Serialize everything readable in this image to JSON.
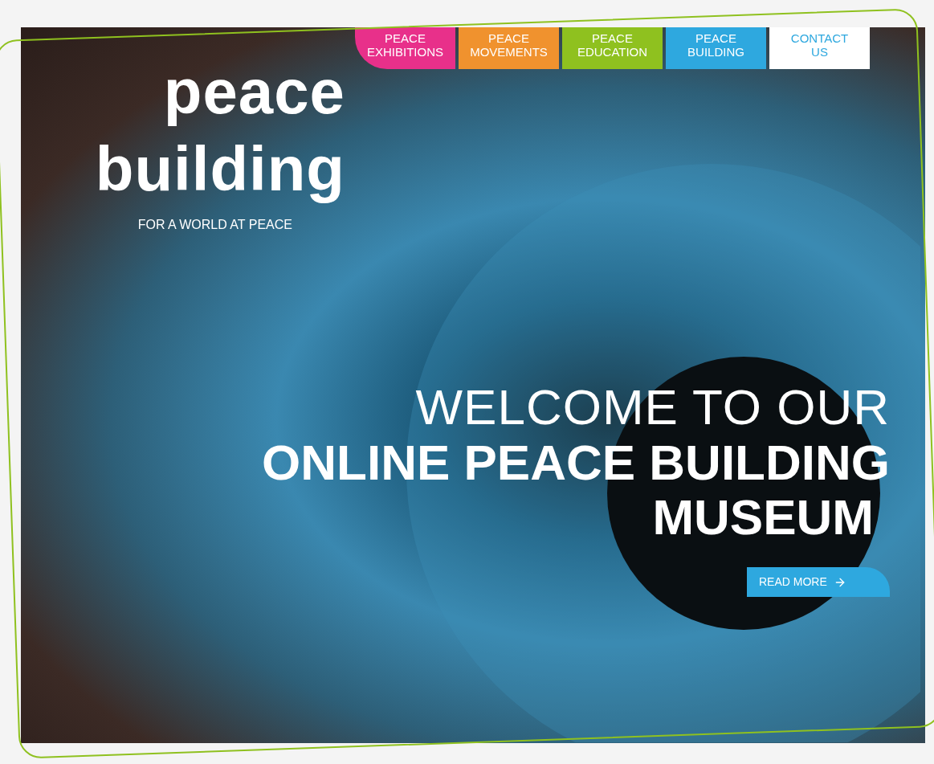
{
  "nav": [
    {
      "label": "PEACE EXHIBITIONS",
      "kind": "filled",
      "color": "#e8308a"
    },
    {
      "label": "PEACE MOVEMENTS",
      "kind": "filled",
      "color": "#f0922e"
    },
    {
      "label": "PEACE EDUCATION",
      "kind": "filled",
      "color": "#8fc11f"
    },
    {
      "label": "PEACE BUILDING",
      "kind": "filled",
      "color": "#2ea8df"
    },
    {
      "label": "CONTACT US",
      "kind": "outline",
      "color": "#2ea8df"
    }
  ],
  "logo": {
    "line_1": "peace",
    "line_2": "building",
    "tagline": "FOR A WORLD AT PEACE"
  },
  "hero": {
    "heading_light": "WELCOME TO OUR",
    "heading_bold_1": "ONLINE PEACE BUILDING",
    "heading_bold_2": "MUSEUM",
    "button": "READ MORE"
  }
}
